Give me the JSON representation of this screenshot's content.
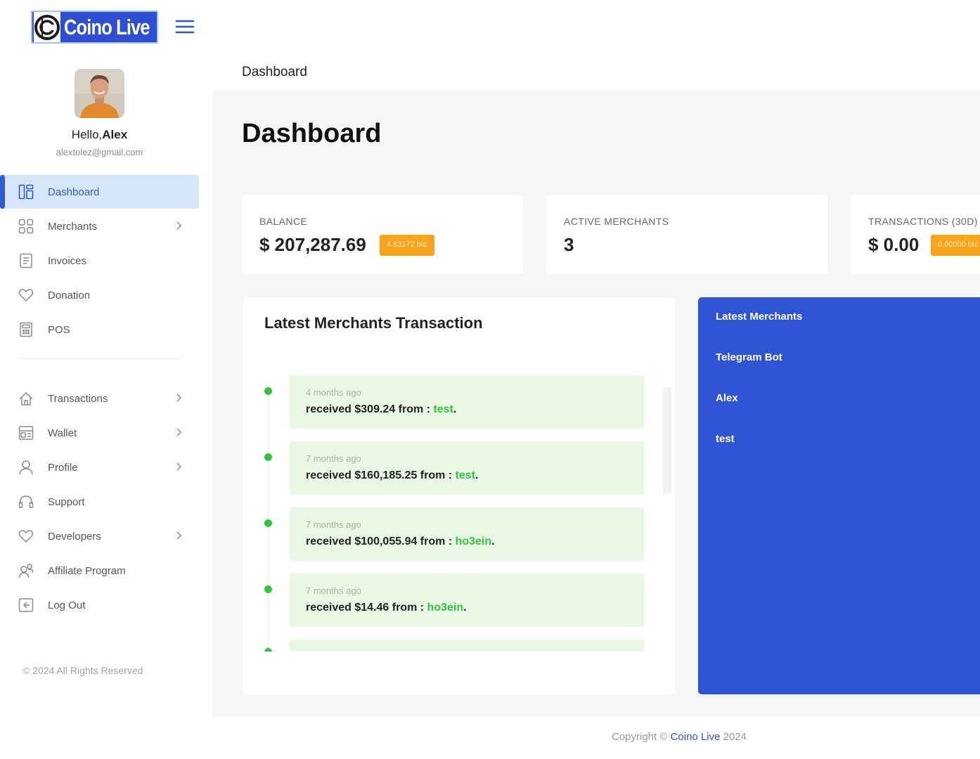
{
  "brand": {
    "logo_text": "Coino Live",
    "logo_color": "#2f4fd3"
  },
  "user": {
    "greeting": "Hello,",
    "name": "Alex",
    "email": "alextolez@gmail.com"
  },
  "sidebar": {
    "items": [
      {
        "label": "Dashboard",
        "icon": "dashboard-icon",
        "active": true,
        "has_children": false
      },
      {
        "label": "Merchants",
        "icon": "grid-icon",
        "active": false,
        "has_children": true
      },
      {
        "label": "Invoices",
        "icon": "document-icon",
        "active": false,
        "has_children": false
      },
      {
        "label": "Donation",
        "icon": "heart-icon",
        "active": false,
        "has_children": false
      },
      {
        "label": "POS",
        "icon": "pos-icon",
        "active": false,
        "has_children": false
      },
      {
        "label": "Transactions",
        "icon": "transactions-icon",
        "active": false,
        "has_children": true
      },
      {
        "label": "Wallet",
        "icon": "wallet-icon",
        "active": false,
        "has_children": true
      },
      {
        "label": "Profile",
        "icon": "user-icon",
        "active": false,
        "has_children": true
      },
      {
        "label": "Support",
        "icon": "headset-icon",
        "active": false,
        "has_children": false
      },
      {
        "label": "Developers",
        "icon": "heart-icon",
        "active": false,
        "has_children": true
      },
      {
        "label": "Affiliate Program",
        "icon": "affiliate-icon",
        "active": false,
        "has_children": false
      },
      {
        "label": "Log Out",
        "icon": "logout-icon",
        "active": false,
        "has_children": false
      }
    ],
    "rights": "© 2024 All Rights Reserved"
  },
  "topbar": {
    "breadcrumb": "Dashboard"
  },
  "page": {
    "title": "Dashboard"
  },
  "stats": {
    "balance": {
      "label": "BALANCE",
      "value": "$ 207,287.69",
      "badge": "4.83172 btc"
    },
    "active_merchants": {
      "label": "ACTIVE MERCHANTS",
      "value": "3"
    },
    "transactions": {
      "label": "TRANSACTIONS (30D)",
      "value": "$ 0.00",
      "badge": "0.00000 btc"
    }
  },
  "latest_transactions": {
    "title": "Latest Merchants Transaction",
    "items": [
      {
        "time": "4 months ago",
        "prefix": "received $309.24 from : ",
        "from": "test",
        "suffix": "."
      },
      {
        "time": "7 months ago",
        "prefix": "received $160,185.25 from : ",
        "from": "test",
        "suffix": "."
      },
      {
        "time": "7 months ago",
        "prefix": "received $100,055.94 from : ",
        "from": "ho3ein",
        "suffix": "."
      },
      {
        "time": "7 months ago",
        "prefix": "received $14.46 from : ",
        "from": "ho3ein",
        "suffix": "."
      }
    ]
  },
  "latest_merchants": {
    "title": "Latest Merchants",
    "items": [
      "Telegram Bot",
      "Alex",
      "test"
    ]
  },
  "footer": {
    "prefix": "Copyright © ",
    "brand": "Coino Live",
    "year": " 2024"
  },
  "colors": {
    "accent": "#2f55d4",
    "active_bg": "#d7e7fb",
    "badge": "#f7a51d",
    "success": "#33c43d",
    "tx_bg": "#e9f7e5"
  }
}
